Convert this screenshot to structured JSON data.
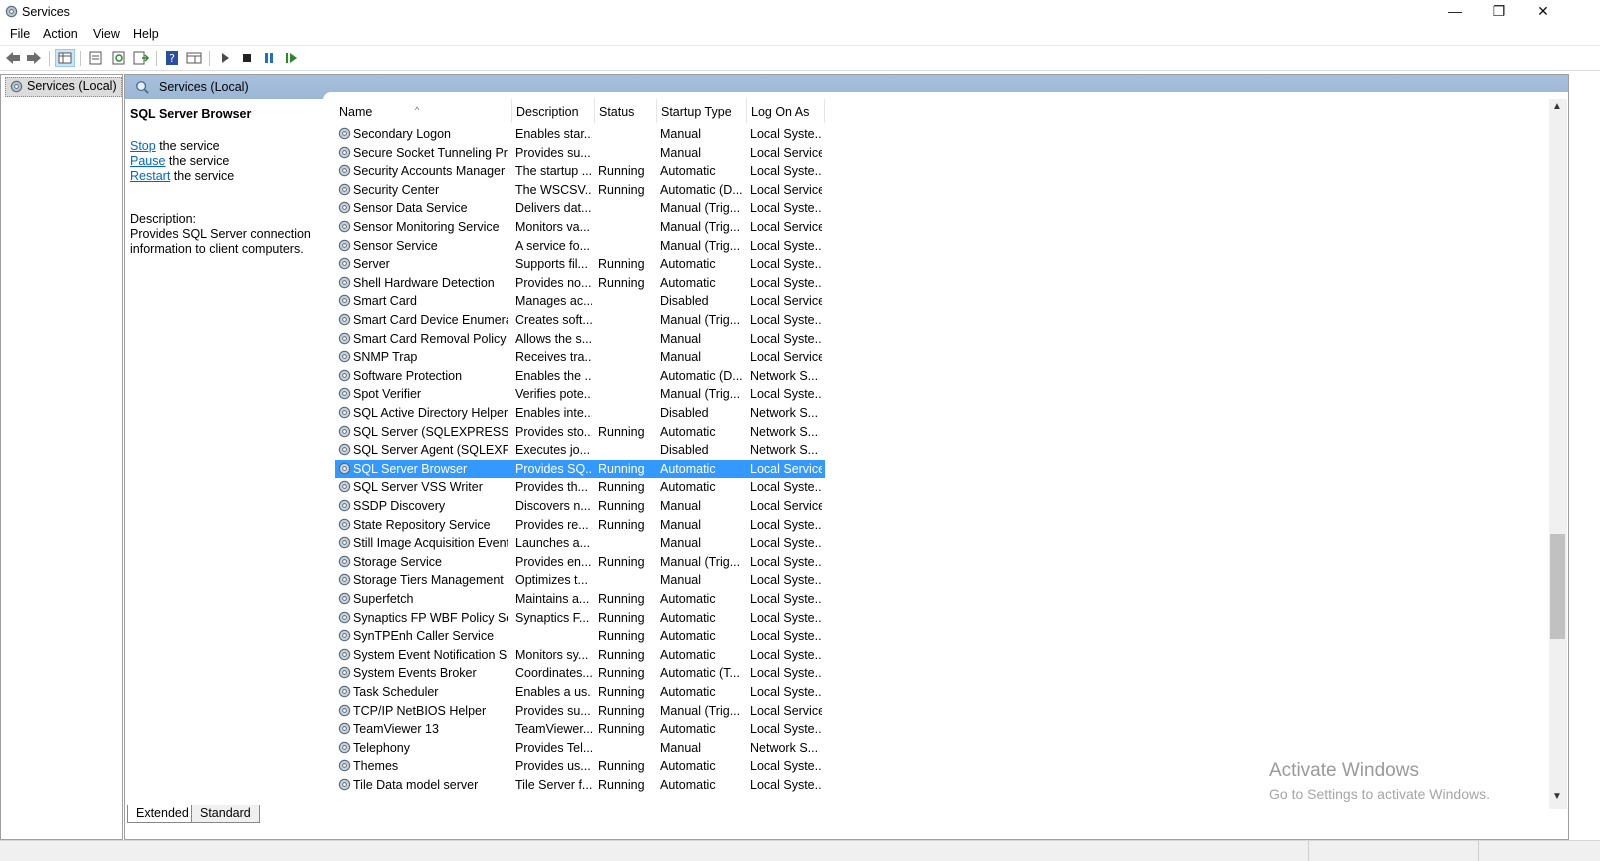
{
  "window": {
    "title": "Services",
    "controls": {
      "minimize": "—",
      "restore": "❐",
      "close": "✕"
    }
  },
  "menu": [
    "File",
    "Action",
    "View",
    "Help"
  ],
  "tree": {
    "root_label": "Services (Local)"
  },
  "panel_header": "Services (Local)",
  "details": {
    "service_name": "SQL Server Browser",
    "actions": [
      {
        "link": "Stop",
        "suffix": " the service"
      },
      {
        "link": "Pause",
        "suffix": " the service"
      },
      {
        "link": "Restart",
        "suffix": " the service"
      }
    ],
    "description_label": "Description:",
    "description_text": "Provides SQL Server connection information to client computers."
  },
  "columns": [
    "Name",
    "Description",
    "Status",
    "Startup Type",
    "Log On As"
  ],
  "sort_indicator": "^",
  "services": [
    {
      "name": "Secondary Logon",
      "desc": "Enables star...",
      "status": "",
      "startup": "Manual",
      "logon": "Local Syste..."
    },
    {
      "name": "Secure Socket Tunneling Pr...",
      "desc": "Provides su...",
      "status": "",
      "startup": "Manual",
      "logon": "Local Service"
    },
    {
      "name": "Security Accounts Manager",
      "desc": "The startup ...",
      "status": "Running",
      "startup": "Automatic",
      "logon": "Local Syste..."
    },
    {
      "name": "Security Center",
      "desc": "The WSCSV...",
      "status": "Running",
      "startup": "Automatic (D...",
      "logon": "Local Service"
    },
    {
      "name": "Sensor Data Service",
      "desc": "Delivers dat...",
      "status": "",
      "startup": "Manual (Trig...",
      "logon": "Local Syste..."
    },
    {
      "name": "Sensor Monitoring Service",
      "desc": "Monitors va...",
      "status": "",
      "startup": "Manual (Trig...",
      "logon": "Local Service"
    },
    {
      "name": "Sensor Service",
      "desc": "A service fo...",
      "status": "",
      "startup": "Manual (Trig...",
      "logon": "Local Syste..."
    },
    {
      "name": "Server",
      "desc": "Supports fil...",
      "status": "Running",
      "startup": "Automatic",
      "logon": "Local Syste..."
    },
    {
      "name": "Shell Hardware Detection",
      "desc": "Provides no...",
      "status": "Running",
      "startup": "Automatic",
      "logon": "Local Syste..."
    },
    {
      "name": "Smart Card",
      "desc": "Manages ac...",
      "status": "",
      "startup": "Disabled",
      "logon": "Local Service"
    },
    {
      "name": "Smart Card Device Enumera...",
      "desc": "Creates soft...",
      "status": "",
      "startup": "Manual (Trig...",
      "logon": "Local Syste..."
    },
    {
      "name": "Smart Card Removal Policy",
      "desc": "Allows the s...",
      "status": "",
      "startup": "Manual",
      "logon": "Local Syste..."
    },
    {
      "name": "SNMP Trap",
      "desc": "Receives tra...",
      "status": "",
      "startup": "Manual",
      "logon": "Local Service"
    },
    {
      "name": "Software Protection",
      "desc": "Enables the ...",
      "status": "",
      "startup": "Automatic (D...",
      "logon": "Network S..."
    },
    {
      "name": "Spot Verifier",
      "desc": "Verifies pote...",
      "status": "",
      "startup": "Manual (Trig...",
      "logon": "Local Syste..."
    },
    {
      "name": "SQL Active Directory Helper...",
      "desc": "Enables inte...",
      "status": "",
      "startup": "Disabled",
      "logon": "Network S..."
    },
    {
      "name": "SQL Server (SQLEXPRESS)",
      "desc": "Provides sto...",
      "status": "Running",
      "startup": "Automatic",
      "logon": "Network S..."
    },
    {
      "name": "SQL Server Agent (SQLEXPR...",
      "desc": "Executes jo...",
      "status": "",
      "startup": "Disabled",
      "logon": "Network S..."
    },
    {
      "name": "SQL Server Browser",
      "desc": "Provides SQ...",
      "status": "Running",
      "startup": "Automatic",
      "logon": "Local Service",
      "selected": true
    },
    {
      "name": "SQL Server VSS Writer",
      "desc": "Provides th...",
      "status": "Running",
      "startup": "Automatic",
      "logon": "Local Syste..."
    },
    {
      "name": "SSDP Discovery",
      "desc": "Discovers n...",
      "status": "Running",
      "startup": "Manual",
      "logon": "Local Service"
    },
    {
      "name": "State Repository Service",
      "desc": "Provides re...",
      "status": "Running",
      "startup": "Manual",
      "logon": "Local Syste..."
    },
    {
      "name": "Still Image Acquisition Events",
      "desc": "Launches a...",
      "status": "",
      "startup": "Manual",
      "logon": "Local Syste..."
    },
    {
      "name": "Storage Service",
      "desc": "Provides en...",
      "status": "Running",
      "startup": "Manual (Trig...",
      "logon": "Local Syste..."
    },
    {
      "name": "Storage Tiers Management",
      "desc": "Optimizes t...",
      "status": "",
      "startup": "Manual",
      "logon": "Local Syste..."
    },
    {
      "name": "Superfetch",
      "desc": "Maintains a...",
      "status": "Running",
      "startup": "Automatic",
      "logon": "Local Syste..."
    },
    {
      "name": "Synaptics FP WBF Policy Ser...",
      "desc": "Synaptics F...",
      "status": "Running",
      "startup": "Automatic",
      "logon": "Local Syste..."
    },
    {
      "name": "SynTPEnh Caller Service",
      "desc": "",
      "status": "Running",
      "startup": "Automatic",
      "logon": "Local Syste..."
    },
    {
      "name": "System Event Notification S...",
      "desc": "Monitors sy...",
      "status": "Running",
      "startup": "Automatic",
      "logon": "Local Syste..."
    },
    {
      "name": "System Events Broker",
      "desc": "Coordinates...",
      "status": "Running",
      "startup": "Automatic (T...",
      "logon": "Local Syste..."
    },
    {
      "name": "Task Scheduler",
      "desc": "Enables a us...",
      "status": "Running",
      "startup": "Automatic",
      "logon": "Local Syste..."
    },
    {
      "name": "TCP/IP NetBIOS Helper",
      "desc": "Provides su...",
      "status": "Running",
      "startup": "Manual (Trig...",
      "logon": "Local Service"
    },
    {
      "name": "TeamViewer 13",
      "desc": "TeamViewer...",
      "status": "Running",
      "startup": "Automatic",
      "logon": "Local Syste..."
    },
    {
      "name": "Telephony",
      "desc": "Provides Tel...",
      "status": "",
      "startup": "Manual",
      "logon": "Network S..."
    },
    {
      "name": "Themes",
      "desc": "Provides us...",
      "status": "Running",
      "startup": "Automatic",
      "logon": "Local Syste..."
    },
    {
      "name": "Tile Data model server",
      "desc": "Tile Server f...",
      "status": "Running",
      "startup": "Automatic",
      "logon": "Local Syste..."
    }
  ],
  "tabs": [
    "Extended",
    "Standard"
  ],
  "watermark": {
    "line1": "Activate Windows",
    "line2": "Go to Settings to activate Windows."
  }
}
